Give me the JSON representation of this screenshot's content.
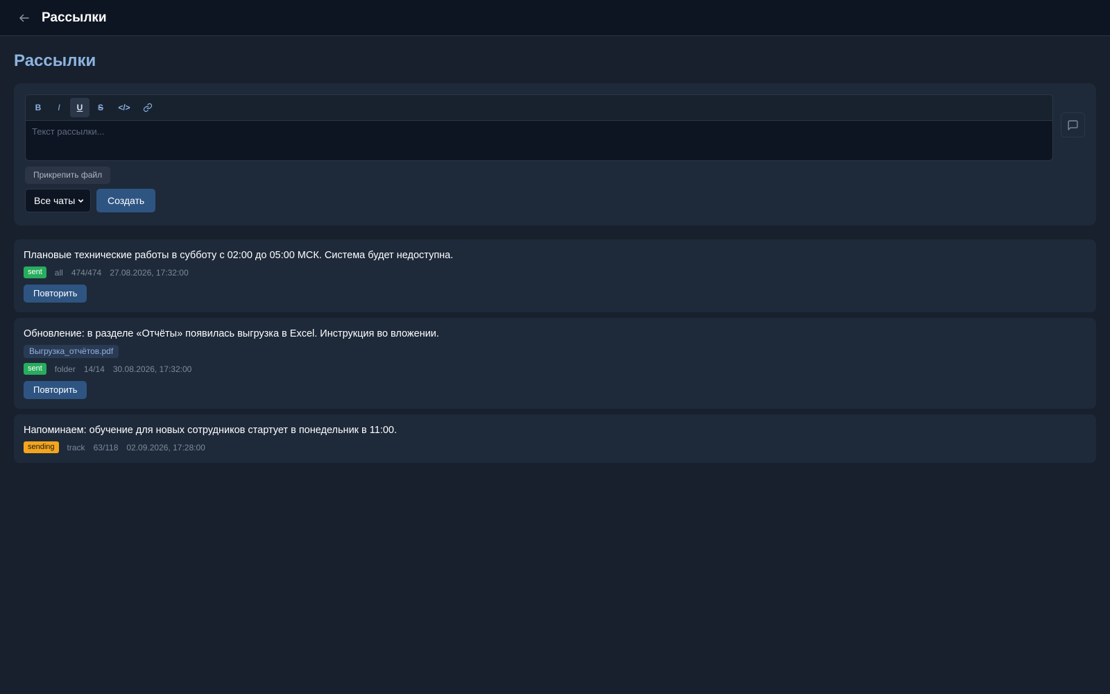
{
  "header": {
    "title": "Рассылки"
  },
  "page": {
    "title": "Рассылки"
  },
  "composer": {
    "toolbar": {
      "bold": "B",
      "italic": "I",
      "underline": "U",
      "strike": "S",
      "code": "</>"
    },
    "placeholder": "Текст рассылки...",
    "attach_label": "Прикрепить файл",
    "target_select": "Все чаты",
    "create_label": "Создать"
  },
  "broadcasts": [
    {
      "text": "Плановые технические работы в субботу с 02:00 до 05:00 МСК. Система будет недоступна.",
      "status": "sent",
      "target": "all",
      "progress": "474/474",
      "date": "27.08.2026, 17:32:00",
      "repeat_label": "Повторить"
    },
    {
      "text": "Обновление: в разделе «Отчёты» появилась выгрузка в Excel. Инструкция во вложении.",
      "attachment": "Выгрузка_отчётов.pdf",
      "status": "sent",
      "target": "folder",
      "progress": "14/14",
      "date": "30.08.2026, 17:32:00",
      "repeat_label": "Повторить"
    },
    {
      "text": "Напоминаем: обучение для новых сотрудников стартует в понедельник в 11:00.",
      "status": "sending",
      "target": "track",
      "progress": "63/118",
      "date": "02.09.2026, 17:28:00"
    }
  ],
  "colors": {
    "accent": "#8db4e2",
    "primary_button": "#2e5482",
    "sent": "#27ad5d",
    "sending": "#f4a51c"
  }
}
